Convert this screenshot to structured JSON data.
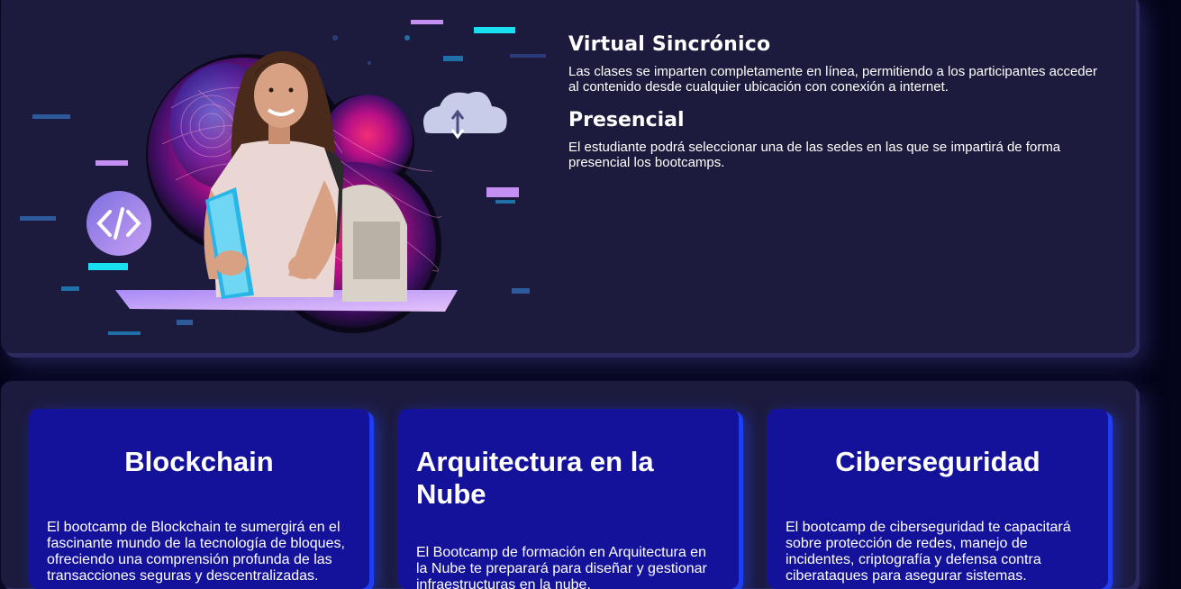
{
  "modalities": [
    {
      "title": "Virtual Sincrónico",
      "description": "Las clases se imparten completamente en línea, permitiendo a los participantes acceder al contenido desde cualquier ubicación con conexión a internet."
    },
    {
      "title": "Presencial",
      "description": "El estudiante podrá seleccionar una de las sedes en las que se impartirá de forma presencial los bootcamps."
    }
  ],
  "hero": {
    "code_badge": "</>",
    "icons": [
      "code-icon",
      "cloud-sync-icon"
    ]
  },
  "bootcamps": [
    {
      "title": "Blockchain",
      "description": "El bootcamp de Blockchain te sumergirá en el fascinante mundo de la tecnología de bloques, ofreciendo una comprensión profunda de las transacciones seguras y descentralizadas."
    },
    {
      "title": "Arquitectura en la Nube",
      "description": "El Bootcamp de formación en Arquitectura en la Nube te preparará para diseñar y gestionar infraestructuras en la nube."
    },
    {
      "title": "Ciberseguridad",
      "description": "El bootcamp de ciberseguridad te capacitará sobre protección de redes, manejo de incidentes, criptografía y defensa contra ciberataques para asegurar sistemas."
    }
  ],
  "colors": {
    "page_background": "#04041a",
    "panel": "#1c1b3e",
    "card": "#14129a",
    "card_glow": "#1f3ef0",
    "accent_pink": "#e0157e",
    "accent_cyan": "#19e0f0",
    "accent_lilac": "#c48ef2"
  }
}
